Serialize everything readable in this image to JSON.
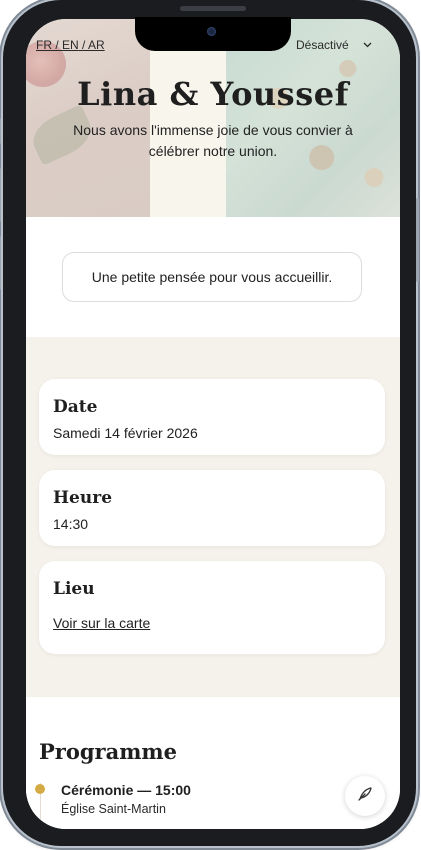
{
  "header": {
    "languages": [
      "FR",
      "EN",
      "AR"
    ],
    "music_status": "Désactivé",
    "names": "Lina & Youssef",
    "invitation_text": "Nous avons l'immense joie de vous convier à célébrer notre union."
  },
  "welcome": {
    "message": "Une petite pensée pour vous accueillir."
  },
  "details": {
    "date_label": "Date",
    "date_value": "Samedi 14 février 2026",
    "time_label": "Heure",
    "time_value": "14:30",
    "place_label": "Lieu",
    "map_link": "Voir sur la carte"
  },
  "programme": {
    "title": "Programme",
    "events": [
      {
        "title": "Cérémonie — 15:00",
        "place": "Église Saint-Martin"
      }
    ]
  },
  "colors": {
    "accent_dot": "#d4aa44",
    "details_background": "#f4f2ea"
  },
  "icons": {
    "fab": "feather-quill-icon",
    "select": "chevron-down-icon"
  }
}
